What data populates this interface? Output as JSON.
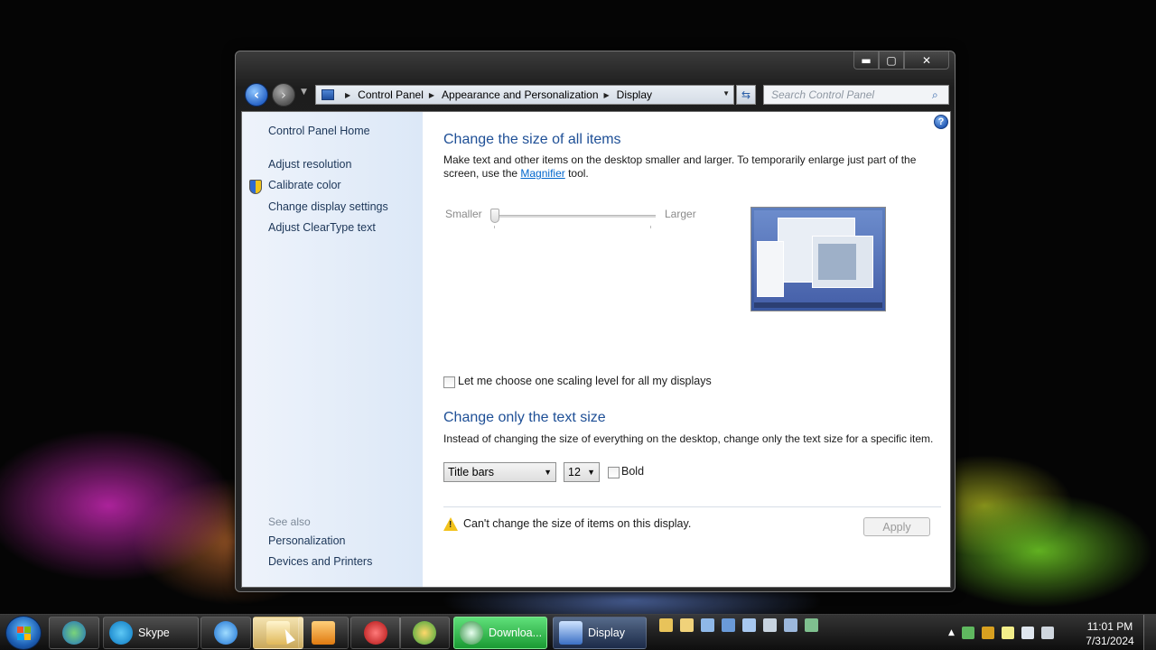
{
  "window": {
    "caption_buttons": {
      "minimize": "▬",
      "maximize": "▢",
      "close": "✕"
    },
    "address": {
      "crumbs": [
        "Control Panel",
        "Appearance and Personalization",
        "Display"
      ]
    },
    "search": {
      "placeholder": "Search Control Panel"
    }
  },
  "left_pane": {
    "home": "Control Panel Home",
    "tasks": [
      "Adjust resolution",
      "Calibrate color",
      "Change display settings",
      "Adjust ClearType text"
    ],
    "see_also_heading": "See also",
    "see_also": [
      "Personalization",
      "Devices and Printers"
    ]
  },
  "main": {
    "section1_title": "Change the size of all items",
    "section1_desc_before": "Make text and other items on the desktop smaller and larger. To temporarily enlarge just part of the screen, use the ",
    "section1_link": "Magnifier",
    "section1_desc_after": " tool.",
    "slider": {
      "min_label": "Smaller",
      "max_label": "Larger",
      "value": 0
    },
    "scaling_checkbox_label": "Let me choose one scaling level for all my displays",
    "section2_title": "Change only the text size",
    "section2_desc": "Instead of changing the size of everything on the desktop, change only the text size for a specific item.",
    "item_select": "Title bars",
    "size_select": "12",
    "bold_label": "Bold",
    "warning": "Can't change the size of items on this display.",
    "apply": "Apply"
  },
  "taskbar": {
    "buttons": [
      {
        "icon": "skype-icon",
        "label": "Skype"
      },
      {
        "icon": "download-icon",
        "label": "Downloa..."
      },
      {
        "icon": "display-icon",
        "label": "Display"
      }
    ],
    "time": "11:01 PM",
    "date": "7/31/2024"
  },
  "colors": {
    "heading": "#1e4f96",
    "link": "#0066cc",
    "left_pane_link": "#1c3658"
  }
}
